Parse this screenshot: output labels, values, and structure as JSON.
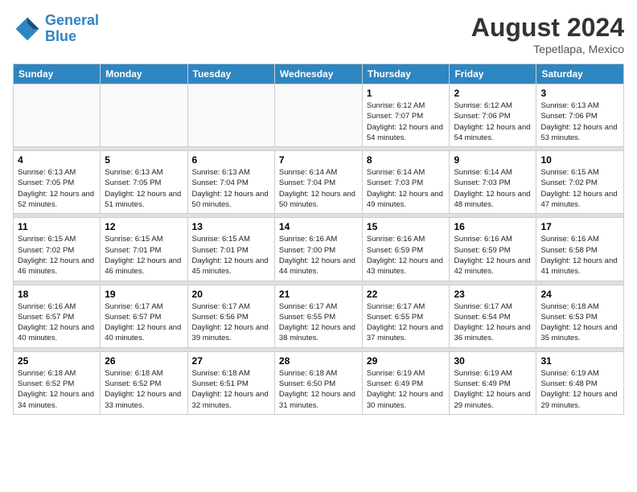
{
  "header": {
    "logo_line1": "General",
    "logo_line2": "Blue",
    "month_year": "August 2024",
    "location": "Tepetlapa, Mexico"
  },
  "weekdays": [
    "Sunday",
    "Monday",
    "Tuesday",
    "Wednesday",
    "Thursday",
    "Friday",
    "Saturday"
  ],
  "weeks": [
    [
      {
        "day": "",
        "empty": true
      },
      {
        "day": "",
        "empty": true
      },
      {
        "day": "",
        "empty": true
      },
      {
        "day": "",
        "empty": true
      },
      {
        "day": "1",
        "sunrise": "Sunrise: 6:12 AM",
        "sunset": "Sunset: 7:07 PM",
        "daylight": "Daylight: 12 hours and 54 minutes."
      },
      {
        "day": "2",
        "sunrise": "Sunrise: 6:12 AM",
        "sunset": "Sunset: 7:06 PM",
        "daylight": "Daylight: 12 hours and 54 minutes."
      },
      {
        "day": "3",
        "sunrise": "Sunrise: 6:13 AM",
        "sunset": "Sunset: 7:06 PM",
        "daylight": "Daylight: 12 hours and 53 minutes."
      }
    ],
    [
      {
        "day": "4",
        "sunrise": "Sunrise: 6:13 AM",
        "sunset": "Sunset: 7:05 PM",
        "daylight": "Daylight: 12 hours and 52 minutes."
      },
      {
        "day": "5",
        "sunrise": "Sunrise: 6:13 AM",
        "sunset": "Sunset: 7:05 PM",
        "daylight": "Daylight: 12 hours and 51 minutes."
      },
      {
        "day": "6",
        "sunrise": "Sunrise: 6:13 AM",
        "sunset": "Sunset: 7:04 PM",
        "daylight": "Daylight: 12 hours and 50 minutes."
      },
      {
        "day": "7",
        "sunrise": "Sunrise: 6:14 AM",
        "sunset": "Sunset: 7:04 PM",
        "daylight": "Daylight: 12 hours and 50 minutes."
      },
      {
        "day": "8",
        "sunrise": "Sunrise: 6:14 AM",
        "sunset": "Sunset: 7:03 PM",
        "daylight": "Daylight: 12 hours and 49 minutes."
      },
      {
        "day": "9",
        "sunrise": "Sunrise: 6:14 AM",
        "sunset": "Sunset: 7:03 PM",
        "daylight": "Daylight: 12 hours and 48 minutes."
      },
      {
        "day": "10",
        "sunrise": "Sunrise: 6:15 AM",
        "sunset": "Sunset: 7:02 PM",
        "daylight": "Daylight: 12 hours and 47 minutes."
      }
    ],
    [
      {
        "day": "11",
        "sunrise": "Sunrise: 6:15 AM",
        "sunset": "Sunset: 7:02 PM",
        "daylight": "Daylight: 12 hours and 46 minutes."
      },
      {
        "day": "12",
        "sunrise": "Sunrise: 6:15 AM",
        "sunset": "Sunset: 7:01 PM",
        "daylight": "Daylight: 12 hours and 46 minutes."
      },
      {
        "day": "13",
        "sunrise": "Sunrise: 6:15 AM",
        "sunset": "Sunset: 7:01 PM",
        "daylight": "Daylight: 12 hours and 45 minutes."
      },
      {
        "day": "14",
        "sunrise": "Sunrise: 6:16 AM",
        "sunset": "Sunset: 7:00 PM",
        "daylight": "Daylight: 12 hours and 44 minutes."
      },
      {
        "day": "15",
        "sunrise": "Sunrise: 6:16 AM",
        "sunset": "Sunset: 6:59 PM",
        "daylight": "Daylight: 12 hours and 43 minutes."
      },
      {
        "day": "16",
        "sunrise": "Sunrise: 6:16 AM",
        "sunset": "Sunset: 6:59 PM",
        "daylight": "Daylight: 12 hours and 42 minutes."
      },
      {
        "day": "17",
        "sunrise": "Sunrise: 6:16 AM",
        "sunset": "Sunset: 6:58 PM",
        "daylight": "Daylight: 12 hours and 41 minutes."
      }
    ],
    [
      {
        "day": "18",
        "sunrise": "Sunrise: 6:16 AM",
        "sunset": "Sunset: 6:57 PM",
        "daylight": "Daylight: 12 hours and 40 minutes."
      },
      {
        "day": "19",
        "sunrise": "Sunrise: 6:17 AM",
        "sunset": "Sunset: 6:57 PM",
        "daylight": "Daylight: 12 hours and 40 minutes."
      },
      {
        "day": "20",
        "sunrise": "Sunrise: 6:17 AM",
        "sunset": "Sunset: 6:56 PM",
        "daylight": "Daylight: 12 hours and 39 minutes."
      },
      {
        "day": "21",
        "sunrise": "Sunrise: 6:17 AM",
        "sunset": "Sunset: 6:55 PM",
        "daylight": "Daylight: 12 hours and 38 minutes."
      },
      {
        "day": "22",
        "sunrise": "Sunrise: 6:17 AM",
        "sunset": "Sunset: 6:55 PM",
        "daylight": "Daylight: 12 hours and 37 minutes."
      },
      {
        "day": "23",
        "sunrise": "Sunrise: 6:17 AM",
        "sunset": "Sunset: 6:54 PM",
        "daylight": "Daylight: 12 hours and 36 minutes."
      },
      {
        "day": "24",
        "sunrise": "Sunrise: 6:18 AM",
        "sunset": "Sunset: 6:53 PM",
        "daylight": "Daylight: 12 hours and 35 minutes."
      }
    ],
    [
      {
        "day": "25",
        "sunrise": "Sunrise: 6:18 AM",
        "sunset": "Sunset: 6:52 PM",
        "daylight": "Daylight: 12 hours and 34 minutes."
      },
      {
        "day": "26",
        "sunrise": "Sunrise: 6:18 AM",
        "sunset": "Sunset: 6:52 PM",
        "daylight": "Daylight: 12 hours and 33 minutes."
      },
      {
        "day": "27",
        "sunrise": "Sunrise: 6:18 AM",
        "sunset": "Sunset: 6:51 PM",
        "daylight": "Daylight: 12 hours and 32 minutes."
      },
      {
        "day": "28",
        "sunrise": "Sunrise: 6:18 AM",
        "sunset": "Sunset: 6:50 PM",
        "daylight": "Daylight: 12 hours and 31 minutes."
      },
      {
        "day": "29",
        "sunrise": "Sunrise: 6:19 AM",
        "sunset": "Sunset: 6:49 PM",
        "daylight": "Daylight: 12 hours and 30 minutes."
      },
      {
        "day": "30",
        "sunrise": "Sunrise: 6:19 AM",
        "sunset": "Sunset: 6:49 PM",
        "daylight": "Daylight: 12 hours and 29 minutes."
      },
      {
        "day": "31",
        "sunrise": "Sunrise: 6:19 AM",
        "sunset": "Sunset: 6:48 PM",
        "daylight": "Daylight: 12 hours and 29 minutes."
      }
    ]
  ]
}
